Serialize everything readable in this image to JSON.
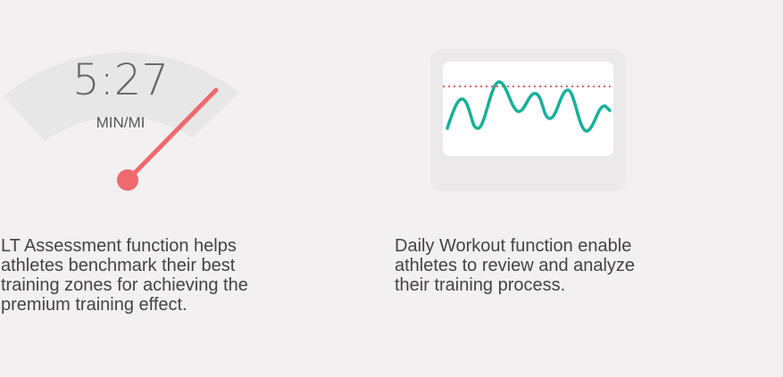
{
  "lt_assessment": {
    "pace_value": "5:27",
    "pace_unit": "MIN/MI",
    "description_lines": [
      "LT Assessment function helps",
      "athletes benchmark their best",
      "training zones for achieving the",
      "premium training effect."
    ],
    "icon": "speedometer-gauge-icon"
  },
  "daily_workout": {
    "description_lines": [
      "Daily Workout function enable",
      "athletes to review and analyze",
      "their training process."
    ],
    "icon": "waveform-monitor-icon"
  },
  "colors": {
    "background": "#f3f0f1",
    "gauge_arc": "#e8e7e7",
    "needle": "#ef6a6e",
    "wave": "#16b09a",
    "threshold_line": "#ef5b63",
    "card": "#ebe9ea",
    "text": "#444444"
  }
}
